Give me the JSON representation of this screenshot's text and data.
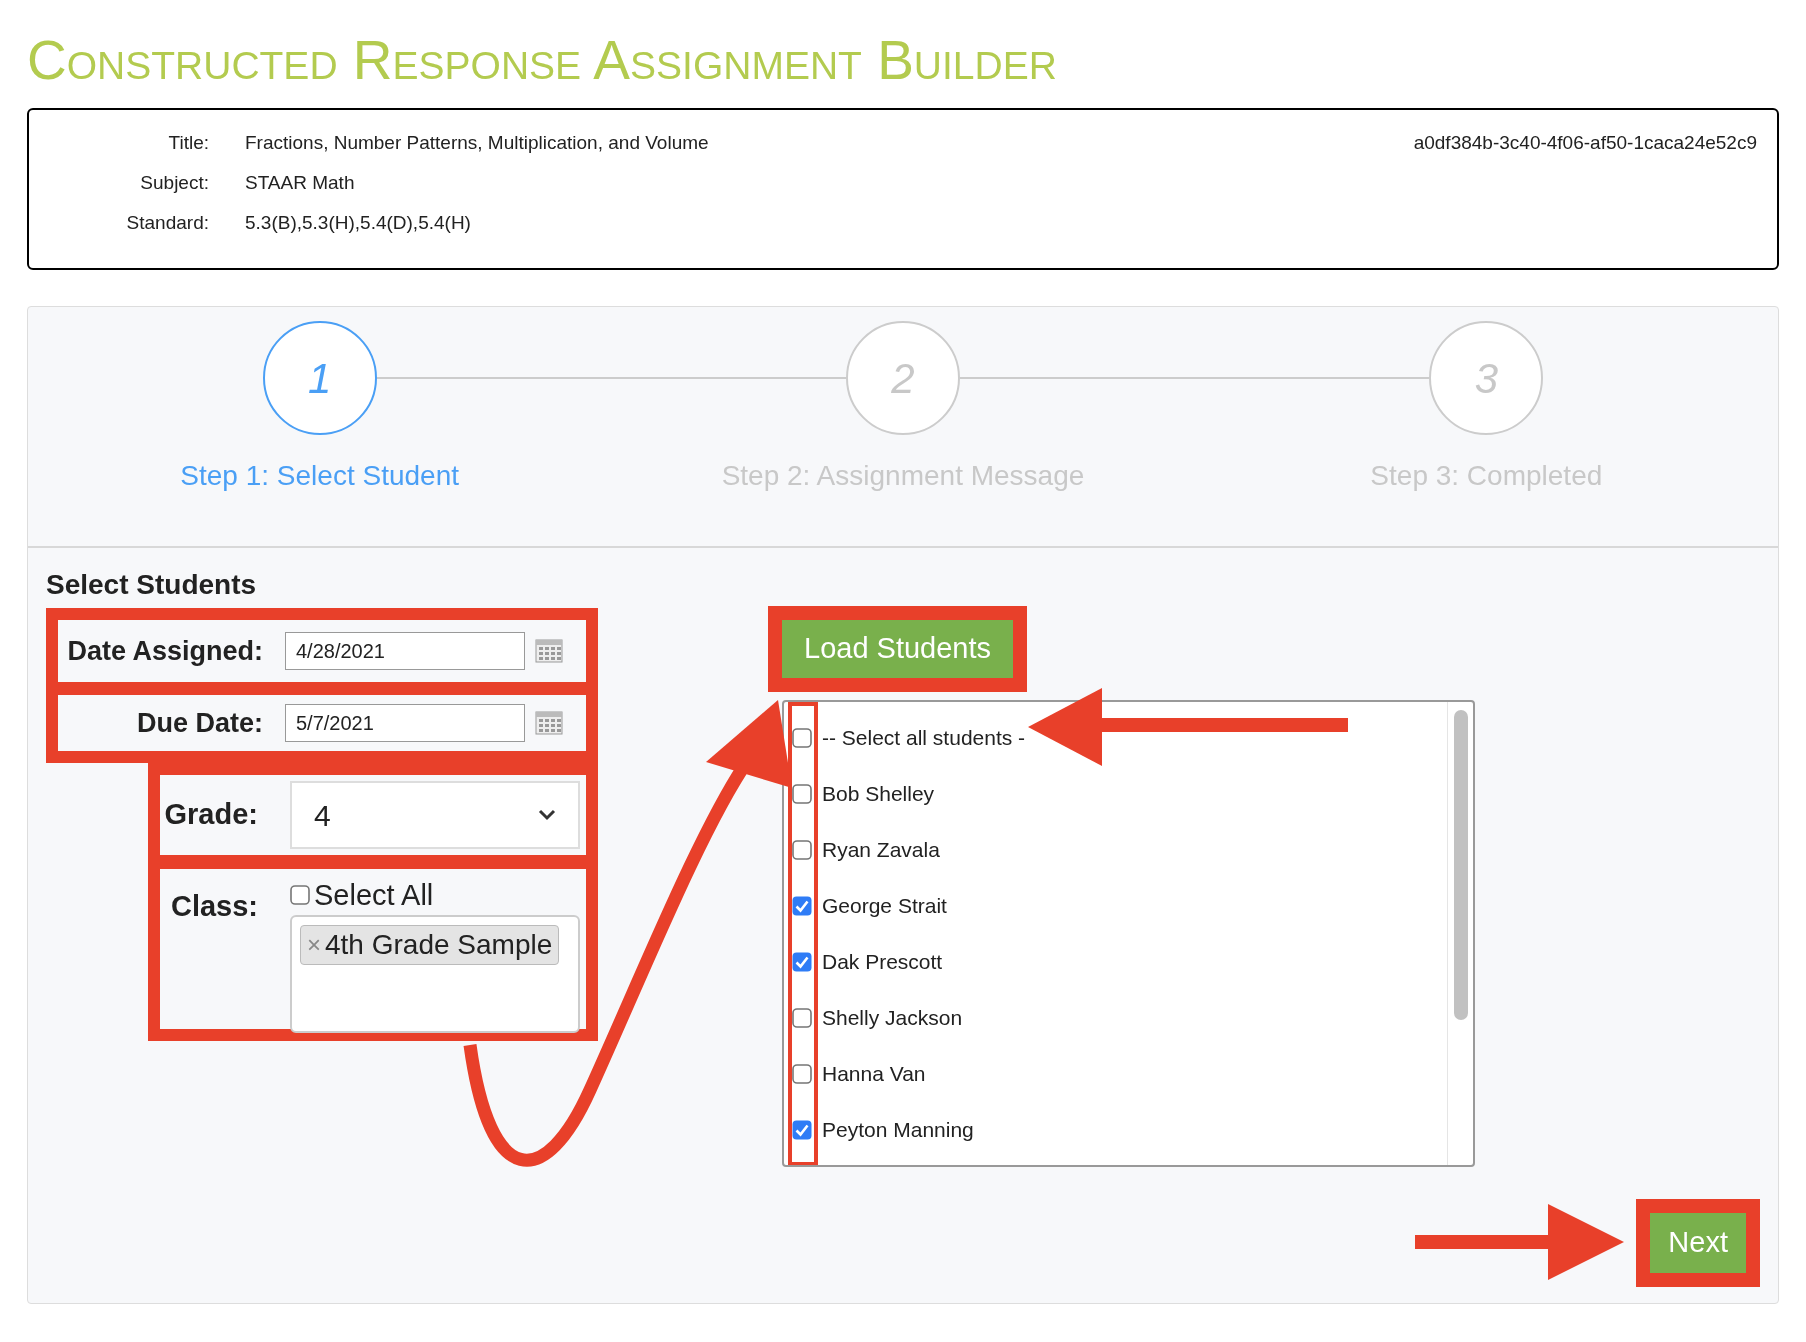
{
  "page_title": "Constructed Response Assignment Builder",
  "info": {
    "fields": [
      {
        "label": "Title:",
        "value": "Fractions, Number Patterns, Multiplication, and Volume"
      },
      {
        "label": "Subject:",
        "value": "STAAR Math"
      },
      {
        "label": "Standard:",
        "value": "5.3(B),5.3(H),5.4(D),5.4(H)"
      }
    ],
    "id": "a0df384b-3c40-4f06-af50-1caca24e52c9"
  },
  "steps": [
    {
      "number": "1",
      "label": "Step 1: Select Student",
      "selected": true
    },
    {
      "number": "2",
      "label": "Step 2: Assignment Message",
      "selected": false
    },
    {
      "number": "3",
      "label": "Step 3: Completed",
      "selected": false
    }
  ],
  "section_title": "Select Students",
  "form": {
    "date_assigned": {
      "label": "Date Assigned:",
      "value": "4/28/2021"
    },
    "due_date": {
      "label": "Due Date:",
      "value": "5/7/2021"
    },
    "grade": {
      "label": "Grade:",
      "value": "4"
    },
    "class": {
      "label": "Class:",
      "select_all": {
        "label": "Select All",
        "checked": false
      },
      "tags": [
        {
          "remove": "×",
          "label": "4th Grade Sample"
        }
      ]
    }
  },
  "load_button": "Load Students",
  "students": [
    {
      "name": "-- Select all students -",
      "checked": false
    },
    {
      "name": "Bob Shelley",
      "checked": false
    },
    {
      "name": "Ryan Zavala",
      "checked": false
    },
    {
      "name": "George Strait",
      "checked": true
    },
    {
      "name": "Dak Prescott",
      "checked": true
    },
    {
      "name": "Shelly Jackson",
      "checked": false
    },
    {
      "name": "Hanna Van",
      "checked": false
    },
    {
      "name": "Peyton Manning",
      "checked": true
    }
  ],
  "next_button": "Next"
}
